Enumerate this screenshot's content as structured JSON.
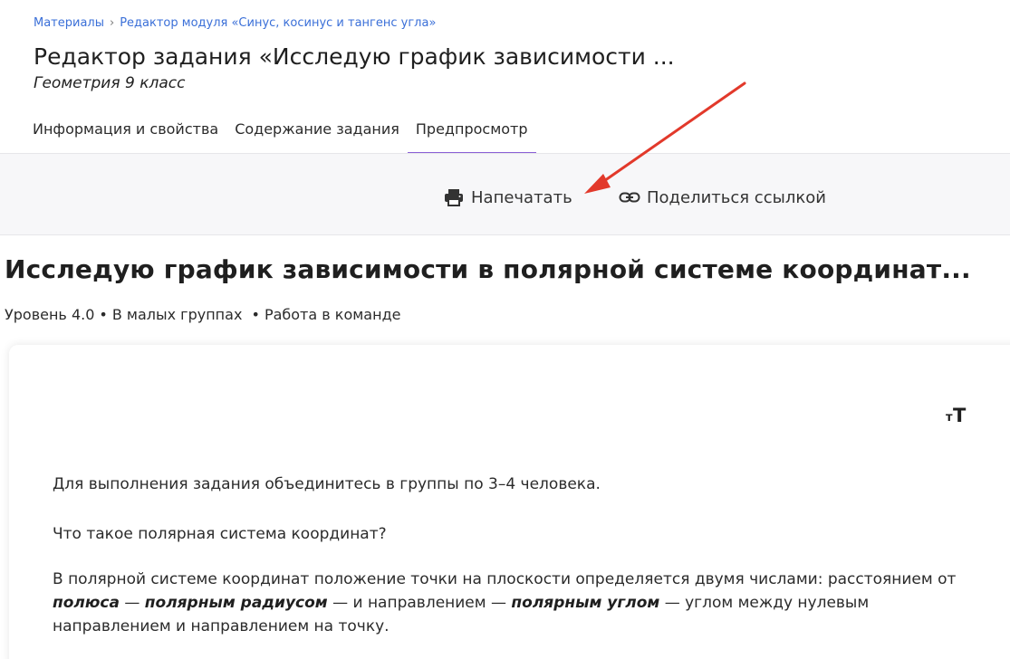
{
  "breadcrumb": {
    "items": [
      "Материалы",
      "Редактор модуля «Синус, косинус и тангенс угла»"
    ],
    "separator": "›"
  },
  "header": {
    "title": "Редактор задания «Исследую график зависимости ...",
    "subject": "Геометрия 9 класс"
  },
  "tabs": [
    {
      "label": "Информация и свойства",
      "active": false
    },
    {
      "label": "Содержание задания",
      "active": false
    },
    {
      "label": "Предпросмотр",
      "active": true
    }
  ],
  "toolbar": {
    "print_label": "Напечатать",
    "print_icon": "printer-icon",
    "share_label": "Поделиться ссылкой",
    "share_icon": "link-icon"
  },
  "task": {
    "title": "Исследую график зависимости в полярной системе координат...",
    "level": "Уровень 4.0",
    "format": "В малых группах ",
    "mode": "Работа в команде",
    "meta_separator": "•"
  },
  "content": {
    "font_size_icon": "font-size-icon",
    "p1": "Для выполнения задания объединитесь в группы по 3–4 человека.",
    "p2": "Что такое полярная система координат?",
    "p3_part1": "В полярной системе координат положение точки на плоскости определяется двумя числами: расстоянием от ",
    "p3_bold1": "полюса",
    "p3_part2": " — ",
    "p3_bold2": "полярным радиусом",
    "p3_part3": " — и направлением — ",
    "p3_bold3": "полярным углом",
    "p3_part4": " — углом между нулевым направлением и направлением на точку."
  },
  "colors": {
    "link": "#3a6fd8",
    "active_tab_underline": "#8a5fd6",
    "toolbar_bg": "#f7f7f9",
    "annotation_arrow": "#e2392b"
  }
}
